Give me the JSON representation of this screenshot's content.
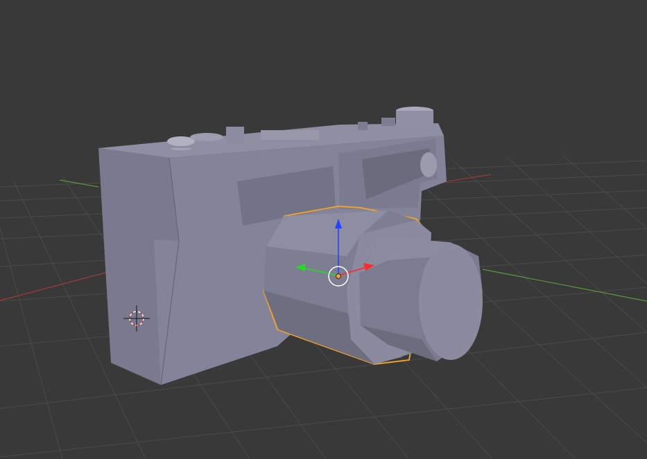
{
  "app": {
    "name": "3D Viewport",
    "view": "perspective"
  },
  "scene": {
    "background_color": "#393939",
    "grid_color": "#4a4a4a",
    "x_axis_color": "#a23a3a",
    "y_axis_color": "#5a9a3c",
    "object": {
      "name": "camera-model",
      "base_color": "#84849a",
      "selection_outline_color": "#f0a030",
      "selected_part": "lens-barrel"
    },
    "gizmo": {
      "x_color": "#ff2a2a",
      "y_color": "#22dd22",
      "z_color": "#2244ff",
      "origin_color": "#f0a040"
    },
    "cursor_icon": "3d-cursor-icon"
  }
}
